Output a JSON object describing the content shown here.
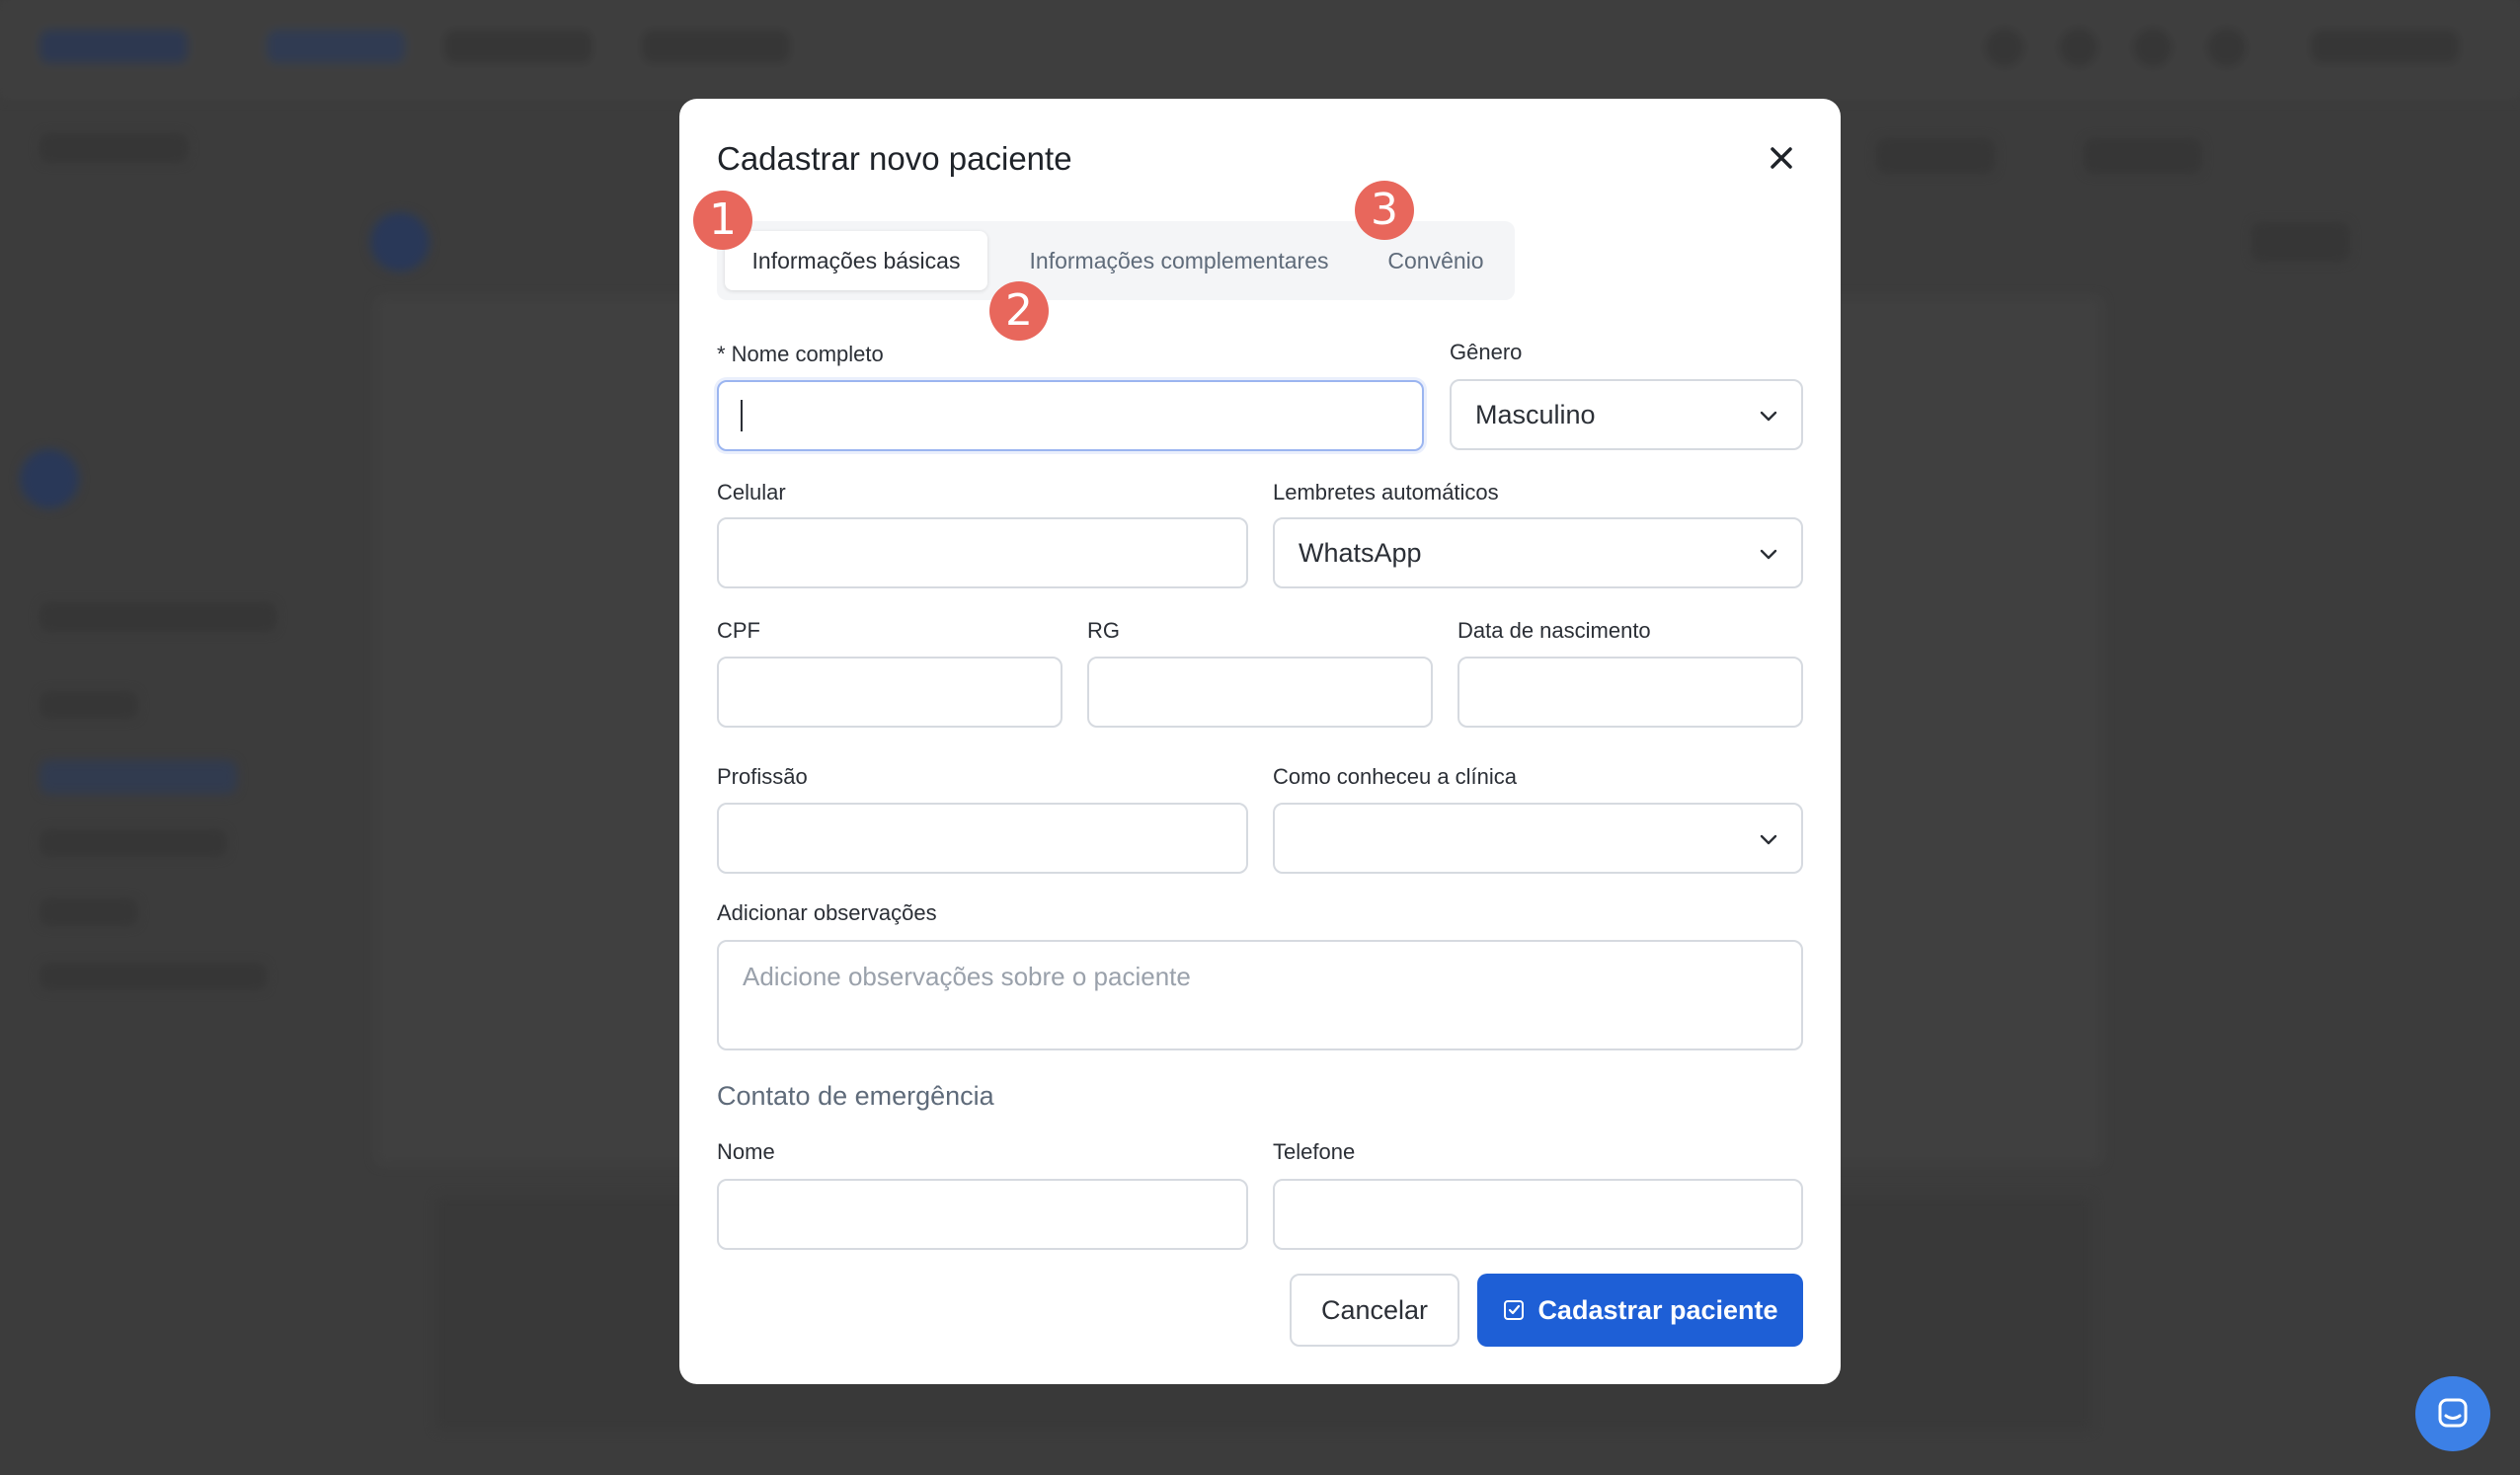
{
  "modal": {
    "title": "Cadastrar novo paciente",
    "tabs": [
      {
        "label": "Informações básicas",
        "active": true
      },
      {
        "label": "Informações complementares",
        "active": false
      },
      {
        "label": "Convênio",
        "active": false
      }
    ],
    "step_badges": [
      "1",
      "2",
      "3"
    ],
    "fields": {
      "nome_completo": {
        "label": "* Nome completo",
        "value": ""
      },
      "genero": {
        "label": "Gênero",
        "value": "Masculino"
      },
      "celular": {
        "label": "Celular",
        "value": ""
      },
      "lembretes": {
        "label": "Lembretes automáticos",
        "value": "WhatsApp"
      },
      "cpf": {
        "label": "CPF",
        "value": ""
      },
      "rg": {
        "label": "RG",
        "value": ""
      },
      "data_nascimento": {
        "label": "Data de nascimento",
        "value": ""
      },
      "profissao": {
        "label": "Profissão",
        "value": ""
      },
      "como_conheceu": {
        "label": "Como conheceu a clínica",
        "value": ""
      },
      "observacoes": {
        "label": "Adicionar observações",
        "placeholder": "Adicione observações sobre o paciente"
      }
    },
    "emergency": {
      "title": "Contato de emergência",
      "nome_label": "Nome",
      "telefone_label": "Telefone"
    },
    "buttons": {
      "cancel": "Cancelar",
      "submit": "Cadastrar paciente"
    }
  },
  "colors": {
    "primary": "#1e5fd6",
    "badge": "#e8675c",
    "backdrop": "#424242",
    "chat_button": "#3c80e6"
  },
  "icons": {
    "close": "close-icon",
    "chevron": "chevron-down-icon",
    "submit": "check-square-icon",
    "chat": "chat-icon"
  }
}
